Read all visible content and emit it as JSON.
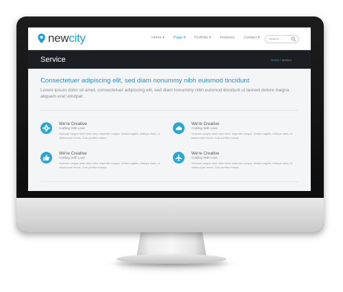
{
  "brand": {
    "name_part1": "new",
    "name_part2": "city",
    "accent": "#1d9ed9"
  },
  "nav": {
    "items": [
      {
        "label": "Home ▾",
        "active": false
      },
      {
        "label": "Page ▾",
        "active": true
      },
      {
        "label": "Portfolio ▾",
        "active": false
      },
      {
        "label": "Features",
        "active": false
      },
      {
        "label": "Contact ▾",
        "active": false
      }
    ],
    "search_placeholder": "Search..."
  },
  "page_header": {
    "title": "Service",
    "breadcrumb": {
      "home": "Home",
      "separator": "/",
      "current": "service"
    }
  },
  "intro": {
    "headline": "Consectetuer adipiscing elit, sed diam nonummy nibh euismod tincidunt",
    "text": "Lorem ipsum dolor sit amet, consectetuer adipiscing elit, sed diam nonummy nibh euismod tincidunt ut laoreet dolore magna aliquam erat volutpat."
  },
  "features": [
    {
      "icon": "gear-icon",
      "title": "We're Creative",
      "subtitle": "Crafting With Love",
      "text": "Vivamus congue diam vitae tortor imperdiet congue. Nullam sagittis, tristique diam, ut ullamcorper lectus. Cras porttitor massa."
    },
    {
      "icon": "cloud-icon",
      "title": "We're Creative",
      "subtitle": "Crafting With Love",
      "text": "Vivamus congue diam vitae tortor imperdiet congue. Nullam sagittis, tristique diam, ut ullamcorper lectus. Cras porttitor massa."
    },
    {
      "icon": "thumbs-up-icon",
      "title": "We're Creative",
      "subtitle": "Crafting With Love",
      "text": "Vivamus congue diam vitae tortor imperdiet congue. Nullam sagittis, tristique diam, ut ullamcorper lectus. Cras porttitor massa."
    },
    {
      "icon": "plane-icon",
      "title": "We're Creative",
      "subtitle": "Crafting With Love",
      "text": "Vivamus congue diam vitae tortor imperdiet congue. Nullam sagittis, tristique diam, ut ullamcorper lectus. Cras porttitor massa."
    }
  ]
}
